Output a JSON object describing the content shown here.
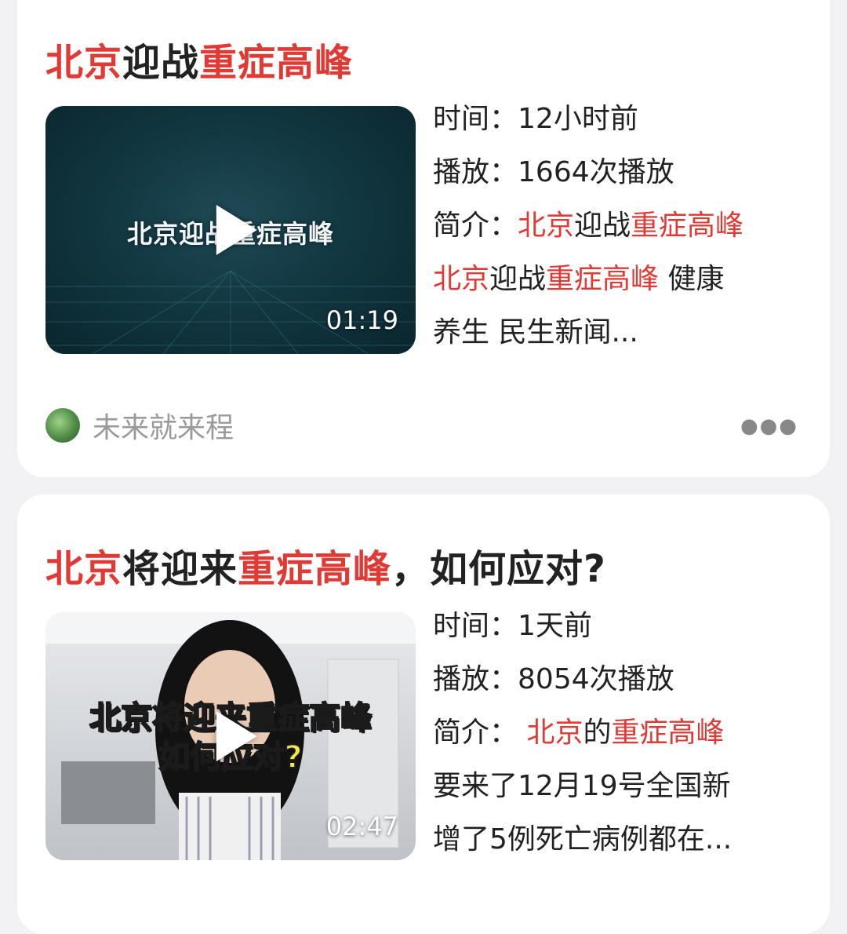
{
  "feed": [
    {
      "title_parts": [
        {
          "text": "北京",
          "highlight": true
        },
        {
          "text": "迎战",
          "highlight": false
        },
        {
          "text": "重症高峰",
          "highlight": true
        }
      ],
      "thumbnail": {
        "overlay_text": "北京迎战重症高峰",
        "duration": "01:19"
      },
      "time_label": "时间：",
      "time_value": "12小时前",
      "plays_label": "播放：",
      "plays_value": "1664次播放",
      "intro_label": "简介：",
      "intro_line1": [
        "北京",
        "迎战",
        "重症高峰"
      ],
      "intro_line2": [
        "北京",
        "迎战",
        "重症高峰",
        " 健康"
      ],
      "intro_line3": "养生 民生新闻...",
      "author": "未来就来程",
      "more_icon": "more-dots-icon"
    },
    {
      "title_parts": [
        {
          "text": "北京",
          "highlight": true
        },
        {
          "text": "将迎来",
          "highlight": false
        },
        {
          "text": "重症高峰",
          "highlight": true
        },
        {
          "text": "，如何应对?",
          "highlight": false
        }
      ],
      "thumbnail": {
        "overlay_line1": "北京将迎来重症高峰",
        "overlay_line2": "如何应对?",
        "duration": "02:47"
      },
      "time_label": "时间：",
      "time_value": "1天前",
      "plays_label": "播放：",
      "plays_value": "8054次播放",
      "intro_label": "简介：",
      "intro_line1": [
        " 北京",
        "的",
        "重症高峰"
      ],
      "intro_line2": "要来了12月19号全国新",
      "intro_line3": "增了5例死亡病例都在..."
    }
  ],
  "colors": {
    "highlight": "#e03a35",
    "text": "#222222",
    "muted": "#9a9a9a",
    "background": "#f2f2f4"
  }
}
